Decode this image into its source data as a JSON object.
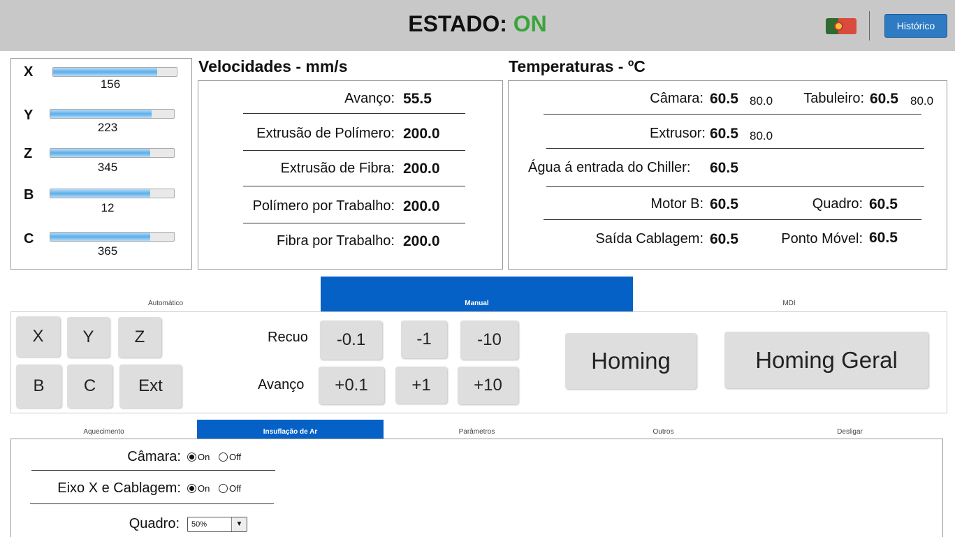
{
  "header": {
    "estado_label": "ESTADO:",
    "estado_value": "ON",
    "historico_label": "Histórico",
    "language_flag": "portugal-flag-icon"
  },
  "axes": [
    {
      "name": "X",
      "value": "156",
      "fill": 0.84
    },
    {
      "name": "Y",
      "value": "223",
      "fill": 0.82
    },
    {
      "name": "Z",
      "value": "345",
      "fill": 0.81
    },
    {
      "name": "B",
      "value": "12",
      "fill": 0.81
    },
    {
      "name": "C",
      "value": "365",
      "fill": 0.81
    }
  ],
  "velocidades": {
    "title": "Velocidades - mm/s",
    "rows": [
      {
        "label": "Avanço:",
        "value": "55.5"
      },
      {
        "label": "Extrusão de Polímero:",
        "value": "200.0"
      },
      {
        "label": "Extrusão de Fibra:",
        "value": "200.0"
      },
      {
        "label": "Polímero por Trabalho:",
        "value": "200.0"
      },
      {
        "label": "Fibra por Trabalho:",
        "value": "200.0"
      }
    ]
  },
  "temperaturas": {
    "title": "Temperaturas - ºC",
    "camara": {
      "label": "Câmara:",
      "value": "60.5",
      "setpoint": "80.0"
    },
    "tabuleiro": {
      "label": "Tabuleiro:",
      "value": "60.5",
      "setpoint": "80.0"
    },
    "extrusor": {
      "label": "Extrusor:",
      "value": "60.5",
      "setpoint": "80.0"
    },
    "agua": {
      "label": "Água á entrada do Chiller:",
      "value": "60.5"
    },
    "motor_b": {
      "label": "Motor B:",
      "value": "60.5"
    },
    "quadro": {
      "label": "Quadro:",
      "value": "60.5"
    },
    "saida": {
      "label": "Saída Cablagem:",
      "value": "60.5"
    },
    "ponto": {
      "label": "Ponto Móvel:",
      "value": "60.5"
    }
  },
  "mode_tabs": {
    "automatico": "Automático",
    "manual": "Manual",
    "mdi": "MDI",
    "active": "Manual"
  },
  "manual": {
    "axis_buttons": [
      "X",
      "Y",
      "Z",
      "B",
      "C",
      "Ext"
    ],
    "recuo_label": "Recuo",
    "avanco_label": "Avanço",
    "recuo_buttons": [
      "-0.1",
      "-1",
      "-10"
    ],
    "avanco_buttons": [
      "+0.1",
      "+1",
      "+10"
    ],
    "homing": "Homing",
    "homing_geral": "Homing Geral"
  },
  "bottom_tabs": {
    "aquecimento": "Aquecimento",
    "insuflacao": "Insuflação de Ar",
    "parametros": "Parâmetros",
    "outros": "Outros",
    "desligar": "Desligar",
    "active": "Insuflação de Ar"
  },
  "insuflacao": {
    "camara_label": "Câmara:",
    "eixo_label": "Eixo X e Cablagem:",
    "quadro_label": "Quadro:",
    "on_label": "On",
    "off_label": "Off",
    "camara_state": "On",
    "eixo_state": "On",
    "quadro_value": "50%"
  }
}
